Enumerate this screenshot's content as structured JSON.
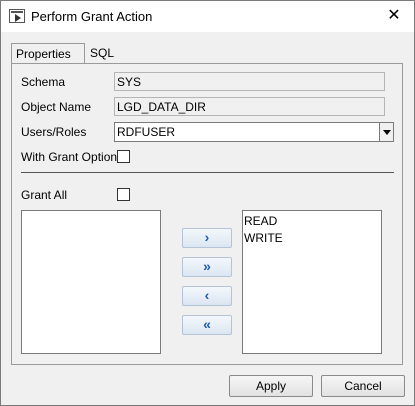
{
  "window": {
    "title": "Perform Grant Action",
    "close_glyph": "✕"
  },
  "tabs": [
    {
      "label": "Properties",
      "active": true
    },
    {
      "label": "SQL",
      "active": false
    }
  ],
  "form": {
    "schema_label": "Schema",
    "schema_value": "SYS",
    "object_name_label": "Object Name",
    "object_name_value": "LGD_DATA_DIR",
    "users_roles_label": "Users/Roles",
    "users_roles_value": "RDFUSER",
    "with_grant_option_label": "With Grant Option",
    "with_grant_option_checked": false,
    "grant_all_label": "Grant All",
    "grant_all_checked": false
  },
  "available_privileges": [],
  "selected_privileges": [
    "READ",
    "WRITE"
  ],
  "move_buttons": {
    "add_one": "›",
    "add_all": "»",
    "remove_one": "‹",
    "remove_all": "«"
  },
  "buttons": {
    "apply": "Apply",
    "cancel": "Cancel"
  }
}
